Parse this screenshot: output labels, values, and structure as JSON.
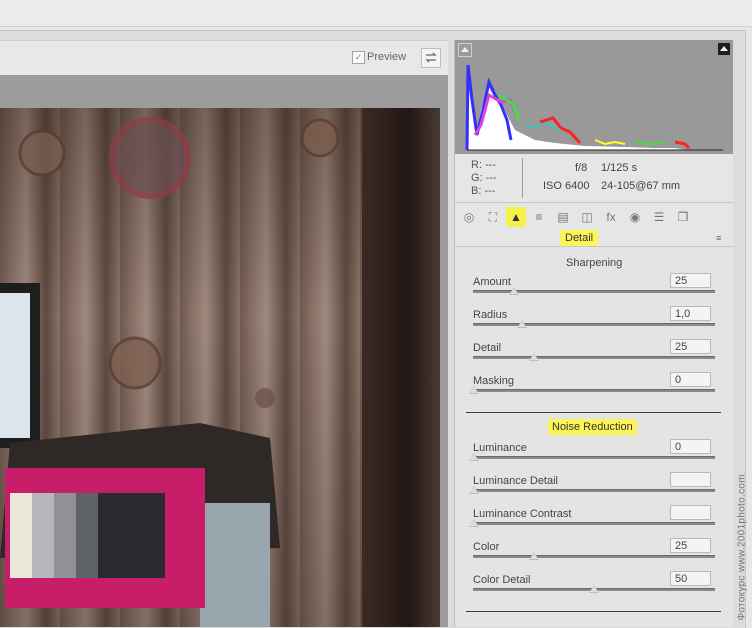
{
  "preview": {
    "label": "Preview",
    "checked_mark": "✓"
  },
  "histogram": {
    "highlight_warning": "highlight-clipping-icon",
    "shadow_warning": "shadow-clipping-icon"
  },
  "info": {
    "r_label": "R:",
    "r_value": "---",
    "g_label": "G:",
    "g_value": "---",
    "b_label": "B:",
    "b_value": "---",
    "aperture": "f/8",
    "shutter": "1/125 s",
    "iso": "ISO 6400",
    "lens": "24-105@67 mm"
  },
  "tabs": [
    {
      "icon": "basic-icon",
      "glyph": "◎"
    },
    {
      "icon": "tone-curve-icon",
      "glyph": "⛶"
    },
    {
      "icon": "detail-icon",
      "glyph": "▲"
    },
    {
      "icon": "hsl-icon",
      "glyph": "≡"
    },
    {
      "icon": "split-toning-icon",
      "glyph": "▤"
    },
    {
      "icon": "lens-corrections-icon",
      "glyph": "◫"
    },
    {
      "icon": "effects-icon",
      "glyph": "fx"
    },
    {
      "icon": "camera-calibration-icon",
      "glyph": "◉"
    },
    {
      "icon": "presets-icon",
      "glyph": "☰"
    },
    {
      "icon": "snapshots-icon",
      "glyph": "❐"
    }
  ],
  "panel": {
    "title": "Detail",
    "menu_glyph": "≡"
  },
  "sharpening": {
    "title": "Sharpening",
    "rows": [
      {
        "label": "Amount",
        "value": "25",
        "pos": 0.167
      },
      {
        "label": "Radius",
        "value": "1,0",
        "pos": 0.2
      },
      {
        "label": "Detail",
        "value": "25",
        "pos": 0.25
      },
      {
        "label": "Masking",
        "value": "0",
        "pos": 0.0
      }
    ]
  },
  "noise": {
    "title": "Noise Reduction",
    "rows": [
      {
        "label": "Luminance",
        "value": "0",
        "pos": 0.0
      },
      {
        "label": "Luminance Detail",
        "value": "",
        "pos": 0.0
      },
      {
        "label": "Luminance Contrast",
        "value": "",
        "pos": 0.0
      },
      {
        "label": "Color",
        "value": "25",
        "pos": 0.25
      },
      {
        "label": "Color Detail",
        "value": "50",
        "pos": 0.5
      }
    ]
  },
  "watermark": "Фотокурс   www.2001photo.com"
}
